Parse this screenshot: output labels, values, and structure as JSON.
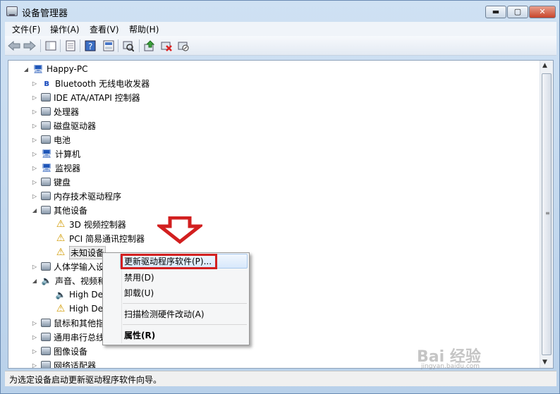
{
  "window": {
    "title": "设备管理器",
    "controls": {
      "minimize": "▬",
      "maximize": "▢",
      "close": "✕"
    }
  },
  "menu": [
    "文件(F)",
    "操作(A)",
    "查看(V)",
    "帮助(H)"
  ],
  "toolbar": [
    "back-arrow-icon",
    "forward-arrow-icon",
    "show-hide-tree-icon",
    "properties-icon",
    "help-icon",
    "view-icon",
    "scan-hardware-icon",
    "update-driver-icon",
    "uninstall-icon",
    "disable-icon"
  ],
  "tree": [
    {
      "label": "Happy-PC",
      "expander": "◢",
      "icon": "computer-icon",
      "glyph": "🖥"
    },
    {
      "label": "Bluetooth 无线电收发器",
      "expander": "▷",
      "icon": "bluetooth-icon",
      "glyph": "ʙ"
    },
    {
      "label": "IDE ATA/ATAPI 控制器",
      "expander": "▷",
      "icon": "ide-controller-icon",
      "glyph": ""
    },
    {
      "label": "处理器",
      "expander": "▷",
      "icon": "processor-icon",
      "glyph": ""
    },
    {
      "label": "磁盘驱动器",
      "expander": "▷",
      "icon": "disk-drive-icon",
      "glyph": ""
    },
    {
      "label": "电池",
      "expander": "▷",
      "icon": "battery-icon",
      "glyph": ""
    },
    {
      "label": "计算机",
      "expander": "▷",
      "icon": "computer-icon",
      "glyph": "🖥"
    },
    {
      "label": "监视器",
      "expander": "▷",
      "icon": "monitor-icon",
      "glyph": "🖥"
    },
    {
      "label": "键盘",
      "expander": "▷",
      "icon": "keyboard-icon",
      "glyph": ""
    },
    {
      "label": "内存技术驱动程序",
      "expander": "▷",
      "icon": "memory-driver-icon",
      "glyph": ""
    },
    {
      "label": "其他设备",
      "expander": "◢",
      "icon": "other-devices-icon",
      "glyph": ""
    },
    {
      "label": "3D 视频控制器",
      "expander": "",
      "icon": "warning-device-icon",
      "glyph": "⚠"
    },
    {
      "label": "PCI 简易通讯控制器",
      "expander": "",
      "icon": "warning-device-icon",
      "glyph": "⚠"
    },
    {
      "label": "未知设备",
      "expander": "",
      "icon": "warning-device-icon",
      "glyph": "⚠"
    },
    {
      "label": "人体学输入设",
      "expander": "▷",
      "icon": "hid-icon",
      "glyph": ""
    },
    {
      "label": "声音、视频和",
      "expander": "◢",
      "icon": "speaker-icon",
      "glyph": "🔈"
    },
    {
      "label": "High De",
      "expander": "",
      "icon": "speaker-icon",
      "glyph": "🔈"
    },
    {
      "label": "High De",
      "expander": "",
      "icon": "speaker-warning-icon",
      "glyph": "⚠"
    },
    {
      "label": "鼠标和其他指",
      "expander": "▷",
      "icon": "mouse-icon",
      "glyph": ""
    },
    {
      "label": "通用串行总线",
      "expander": "▷",
      "icon": "usb-icon",
      "glyph": ""
    },
    {
      "label": "图像设备",
      "expander": "▷",
      "icon": "camera-icon",
      "glyph": ""
    },
    {
      "label": "网络适配器",
      "expander": "▷",
      "icon": "network-adapter-icon",
      "glyph": ""
    }
  ],
  "context_menu": [
    {
      "label": "更新驱动程序软件(P)..."
    },
    {
      "label": "禁用(D)"
    },
    {
      "label": "卸载(U)"
    },
    {
      "label": "扫描检测硬件改动(A)"
    },
    {
      "label": "属性(R)"
    }
  ],
  "status_text": "为选定设备启动更新驱动程序软件向导。",
  "watermark": {
    "brand": "Bai 经验",
    "url": "jingyan.baidu.com"
  },
  "colors": {
    "highlight_border": "#d21f1f",
    "arrow": "#d21f1f"
  }
}
